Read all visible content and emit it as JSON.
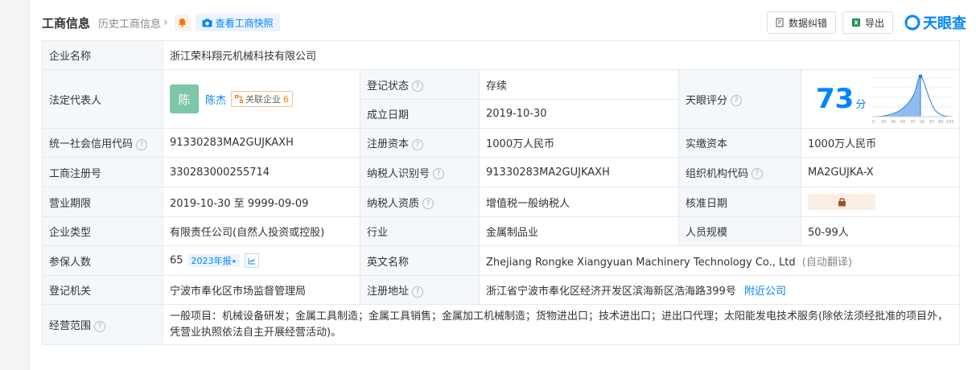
{
  "header": {
    "title": "工商信息",
    "history_label": "历史工商信息",
    "snapshot_label": "查看工商快照",
    "correction_label": "数据纠错",
    "export_label": "导出",
    "brand": "天眼查"
  },
  "rows": {
    "company_name_label": "企业名称",
    "company_name": "浙江荣科翔元机械科技有限公司",
    "legal_rep_label": "法定代表人",
    "legal_rep_avatar": "陈",
    "legal_rep_name": "陈杰",
    "related_label": "关联企业",
    "related_count": "6",
    "reg_status_label": "登记状态",
    "reg_status": "存续",
    "founded_label": "成立日期",
    "founded": "2019-10-30",
    "tianyan_score_label": "天眼评分",
    "score": "73",
    "score_unit": "分",
    "credit_code_label": "统一社会信用代码",
    "credit_code": "91330283MA2GUJKAXH",
    "reg_capital_label": "注册资本",
    "reg_capital": "1000万人民币",
    "paid_capital_label": "实缴资本",
    "paid_capital": "1000万人民币",
    "biz_reg_no_label": "工商注册号",
    "biz_reg_no": "330283000255714",
    "taxpayer_id_label": "纳税人识别号",
    "taxpayer_id": "91330283MA2GUJKAXH",
    "org_code_label": "组织机构代码",
    "org_code": "MA2GUJKA-X",
    "term_label": "营业期限",
    "term": "2019-10-30 至 9999-09-09",
    "taxpayer_qual_label": "纳税人资质",
    "taxpayer_qual": "增值税一般纳税人",
    "approval_date_label": "核准日期",
    "type_label": "企业类型",
    "type": "有限责任公司(自然人投资或控股)",
    "industry_label": "行业",
    "industry": "金属制品业",
    "staff_size_label": "人员规模",
    "staff_size": "50-99人",
    "insured_label": "参保人数",
    "insured": "65",
    "insured_year": "2023年报",
    "english_name_label": "英文名称",
    "english_name": "Zhejiang Rongke Xiangyuan Machinery Technology Co., Ltd",
    "english_note": "(自动翻译)",
    "authority_label": "登记机关",
    "authority": "宁波市奉化区市场监督管理局",
    "address_label": "注册地址",
    "address": "浙江省宁波市奉化区经济开发区滨海新区浩海路399号",
    "nearby_label": "附近公司",
    "scope_label": "经营范围",
    "scope": "一般项目：机械设备研发；金属工具制造；金属工具销售；金属加工机械制造；货物进出口；技术进出口；进出口代理；太阳能发电技术服务(除依法须经批准的项目外，凭营业执照依法自主开展经营活动)。"
  },
  "score_chart": {
    "x_ticks": [
      "0",
      "10",
      "30",
      "50",
      "70",
      "90",
      "97",
      "99",
      "100"
    ]
  },
  "colors": {
    "accent": "#0084ff",
    "status_green": "#1a9c5b",
    "label_bg": "#f5f8fb",
    "border": "#e5e8ee"
  }
}
